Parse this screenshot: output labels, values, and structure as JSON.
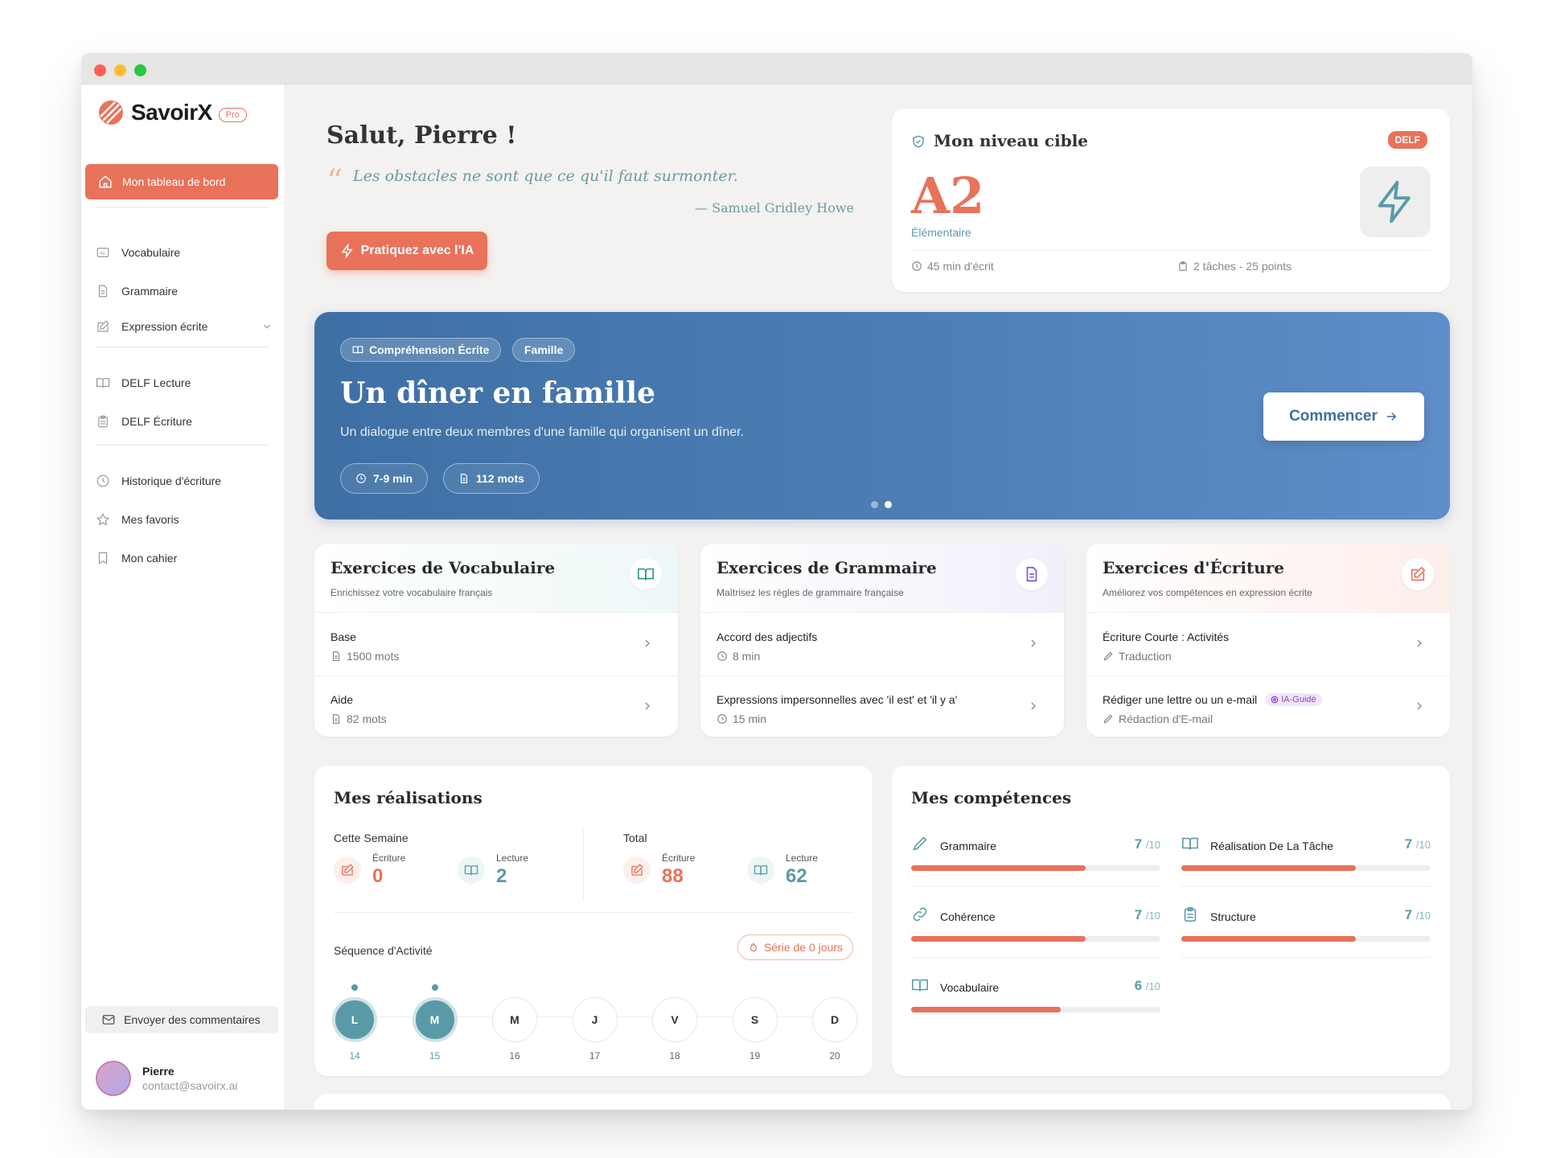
{
  "app": {
    "name": "SavoirX",
    "plan": "Pro"
  },
  "sidebar": {
    "active": "Mon tableau de bord",
    "items": [
      {
        "label": "Vocabulaire",
        "icon": "dictionary-icon"
      },
      {
        "label": "Grammaire",
        "icon": "document-icon"
      },
      {
        "label": "Expression écrite",
        "icon": "pencil-square-icon"
      },
      {
        "label": "DELF Lecture",
        "icon": "open-book-icon"
      },
      {
        "label": "DELF Écriture",
        "icon": "clipboard-icon"
      },
      {
        "label": "Historique d'écriture",
        "icon": "clock-icon"
      },
      {
        "label": "Mes favoris",
        "icon": "star-icon"
      },
      {
        "label": "Mon cahier",
        "icon": "bookmark-icon"
      }
    ],
    "feedback": "Envoyer des commentaires",
    "user": {
      "name": "Pierre",
      "email": "contact@savoirx.ai"
    }
  },
  "greeting": {
    "title": "Salut, Pierre !",
    "quote": "Les obstacles ne sont que ce qu'il faut surmonter.",
    "author": "— Samuel Gridley Howe",
    "cta": "Pratiquez avec l'IA"
  },
  "target": {
    "title": "Mon niveau cible",
    "badge": "DELF",
    "level": "A2",
    "level_name": "Élémentaire",
    "duration": "45 min d'écrit",
    "tasks": "2 tâches - 25 points"
  },
  "hero": {
    "tags": [
      "Compréhension Écrite",
      "Famille"
    ],
    "title": "Un dîner en famille",
    "description": "Un dialogue entre deux membres d'une famille qui organisent un dîner.",
    "duration": "7-9 min",
    "words": "112 mots",
    "button": "Commencer",
    "slides": 2,
    "active_slide": 2
  },
  "exercises": [
    {
      "title": "Exercices de Vocabulaire",
      "subtitle": "Enrichissez votre vocabulaire français",
      "rows": [
        {
          "title": "Base",
          "meta": "1500 mots"
        },
        {
          "title": "Aide",
          "meta": "82 mots"
        }
      ]
    },
    {
      "title": "Exercices de Grammaire",
      "subtitle": "Maîtrisez les règles de grammaire française",
      "rows": [
        {
          "title": "Accord des adjectifs",
          "meta": "8 min"
        },
        {
          "title": "Expressions impersonnelles avec 'il est' et 'il y a'",
          "meta": "15 min"
        }
      ]
    },
    {
      "title": "Exercices d'Écriture",
      "subtitle": "Améliorez vos compétences en expression écrite",
      "rows": [
        {
          "title": "Écriture Courte : Activités",
          "meta": "Traduction"
        },
        {
          "title": "Rédiger une lettre ou un e-mail",
          "badge": "IA-Guidé",
          "meta": "Rédaction d'E-mail"
        }
      ]
    }
  ],
  "achievements": {
    "title": "Mes réalisations",
    "week_label": "Cette Semaine",
    "total_label": "Total",
    "writing_label": "Écriture",
    "reading_label": "Lecture",
    "week": {
      "writing": "0",
      "reading": "2"
    },
    "total": {
      "writing": "88",
      "reading": "62"
    },
    "sequence_label": "Séquence d'Activité",
    "streak": "Série de 0 jours",
    "days": [
      {
        "letter": "L",
        "num": "14",
        "active": true
      },
      {
        "letter": "M",
        "num": "15",
        "active": true
      },
      {
        "letter": "M",
        "num": "16",
        "active": false
      },
      {
        "letter": "J",
        "num": "17",
        "active": false
      },
      {
        "letter": "V",
        "num": "18",
        "active": false
      },
      {
        "letter": "S",
        "num": "19",
        "active": false
      },
      {
        "letter": "D",
        "num": "20",
        "active": false
      }
    ]
  },
  "skills": {
    "title": "Mes compétences",
    "max": "/10",
    "items": [
      {
        "name": "Grammaire",
        "score": 7,
        "icon": "pencil-icon"
      },
      {
        "name": "Réalisation De La Tâche",
        "score": 7,
        "icon": "open-book-icon"
      },
      {
        "name": "Cohérence",
        "score": 7,
        "icon": "link-icon"
      },
      {
        "name": "Structure",
        "score": 7,
        "icon": "clipboard-icon"
      },
      {
        "name": "Vocabulaire",
        "score": 6,
        "icon": "open-book-icon"
      }
    ]
  },
  "colors": {
    "accent": "#e8725a",
    "teal": "#5a9aa8",
    "hero": "#4d7fb6"
  }
}
